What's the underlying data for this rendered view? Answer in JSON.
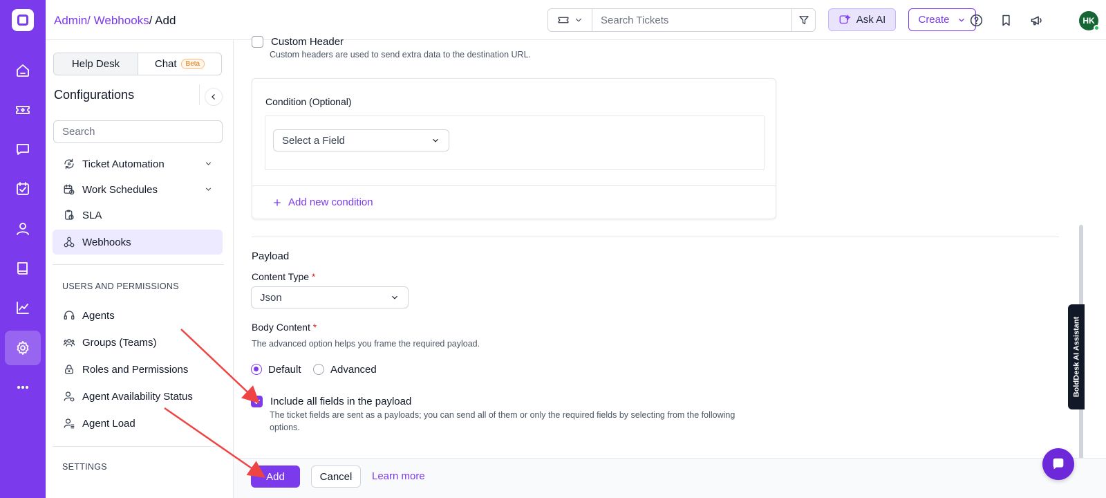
{
  "breadcrumb": {
    "part1": "Admin/",
    "part2": " Webhooks",
    "part3": "/ Add"
  },
  "topbar": {
    "search_placeholder": "Search Tickets",
    "ask_ai_label": "Ask AI",
    "create_label": "Create",
    "avatar_initials": "HK"
  },
  "config": {
    "tab_helpdesk": "Help Desk",
    "tab_chat": "Chat",
    "chat_badge": "Beta",
    "title": "Configurations",
    "search_placeholder": "Search",
    "nav_items": [
      {
        "label": "Ticket Automation"
      },
      {
        "label": "Work Schedules"
      },
      {
        "label": "SLA"
      },
      {
        "label": "Webhooks"
      }
    ],
    "users_section": "USERS AND PERMISSIONS",
    "users_items": [
      {
        "label": "Agents"
      },
      {
        "label": "Groups (Teams)"
      },
      {
        "label": "Roles and Permissions"
      },
      {
        "label": "Agent Availability Status"
      },
      {
        "label": "Agent Load"
      }
    ],
    "settings_section": "SETTINGS"
  },
  "form": {
    "custom_header_label": "Custom Header",
    "custom_header_help": "Custom headers are used to send extra data to the destination URL.",
    "condition_title": "Condition (Optional)",
    "select_field_placeholder": "Select a Field",
    "add_condition_label": "Add new condition",
    "payload_title": "Payload",
    "content_type_label": "Content Type",
    "content_type_value": "Json",
    "body_content_label": "Body Content",
    "body_content_help": "The advanced option helps you frame the required payload.",
    "radio_default": "Default",
    "radio_advanced": "Advanced",
    "include_all_label": "Include all fields in the payload",
    "include_all_help": "The ticket fields are sent as a payloads; you can send all of them or only the required fields by selecting from the following options.",
    "required_mark": "*"
  },
  "footer": {
    "add_label": "Add",
    "cancel_label": "Cancel",
    "learn_more": "Learn more"
  },
  "ai_assistant_tab": "BoldDesk AI Assistant",
  "colors": {
    "brand": "#7c3aed",
    "annotation_arrow": "#ef4444"
  }
}
